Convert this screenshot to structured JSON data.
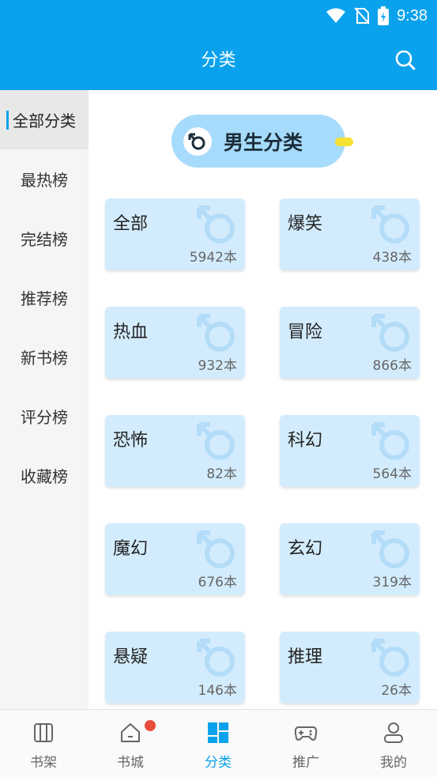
{
  "status": {
    "time": "9:38"
  },
  "header": {
    "title": "分类"
  },
  "sidebar": {
    "items": [
      {
        "label": "全部分类",
        "active": true
      },
      {
        "label": "最热榜"
      },
      {
        "label": "完结榜"
      },
      {
        "label": "推荐榜"
      },
      {
        "label": "新书榜"
      },
      {
        "label": "评分榜"
      },
      {
        "label": "收藏榜"
      }
    ]
  },
  "section": {
    "title": "男生分类"
  },
  "categories": [
    {
      "name": "全部",
      "count": "5942本"
    },
    {
      "name": "爆笑",
      "count": "438本"
    },
    {
      "name": "热血",
      "count": "932本"
    },
    {
      "name": "冒险",
      "count": "866本"
    },
    {
      "name": "恐怖",
      "count": "82本"
    },
    {
      "name": "科幻",
      "count": "564本"
    },
    {
      "name": "魔幻",
      "count": "676本"
    },
    {
      "name": "玄幻",
      "count": "319本"
    },
    {
      "name": "悬疑",
      "count": "146本"
    },
    {
      "name": "推理",
      "count": "26本"
    }
  ],
  "bottom_nav": [
    {
      "label": "书架",
      "icon": "bookshelf-icon"
    },
    {
      "label": "书城",
      "icon": "home-icon"
    },
    {
      "label": "分类",
      "icon": "category-icon",
      "active": true
    },
    {
      "label": "推广",
      "icon": "gamepad-icon"
    },
    {
      "label": "我的",
      "icon": "user-icon"
    }
  ],
  "colors": {
    "accent": "#0aa2ec",
    "card": "#d3ecfd",
    "pill": "#a6dbfb",
    "badge": "#e94b3c"
  }
}
